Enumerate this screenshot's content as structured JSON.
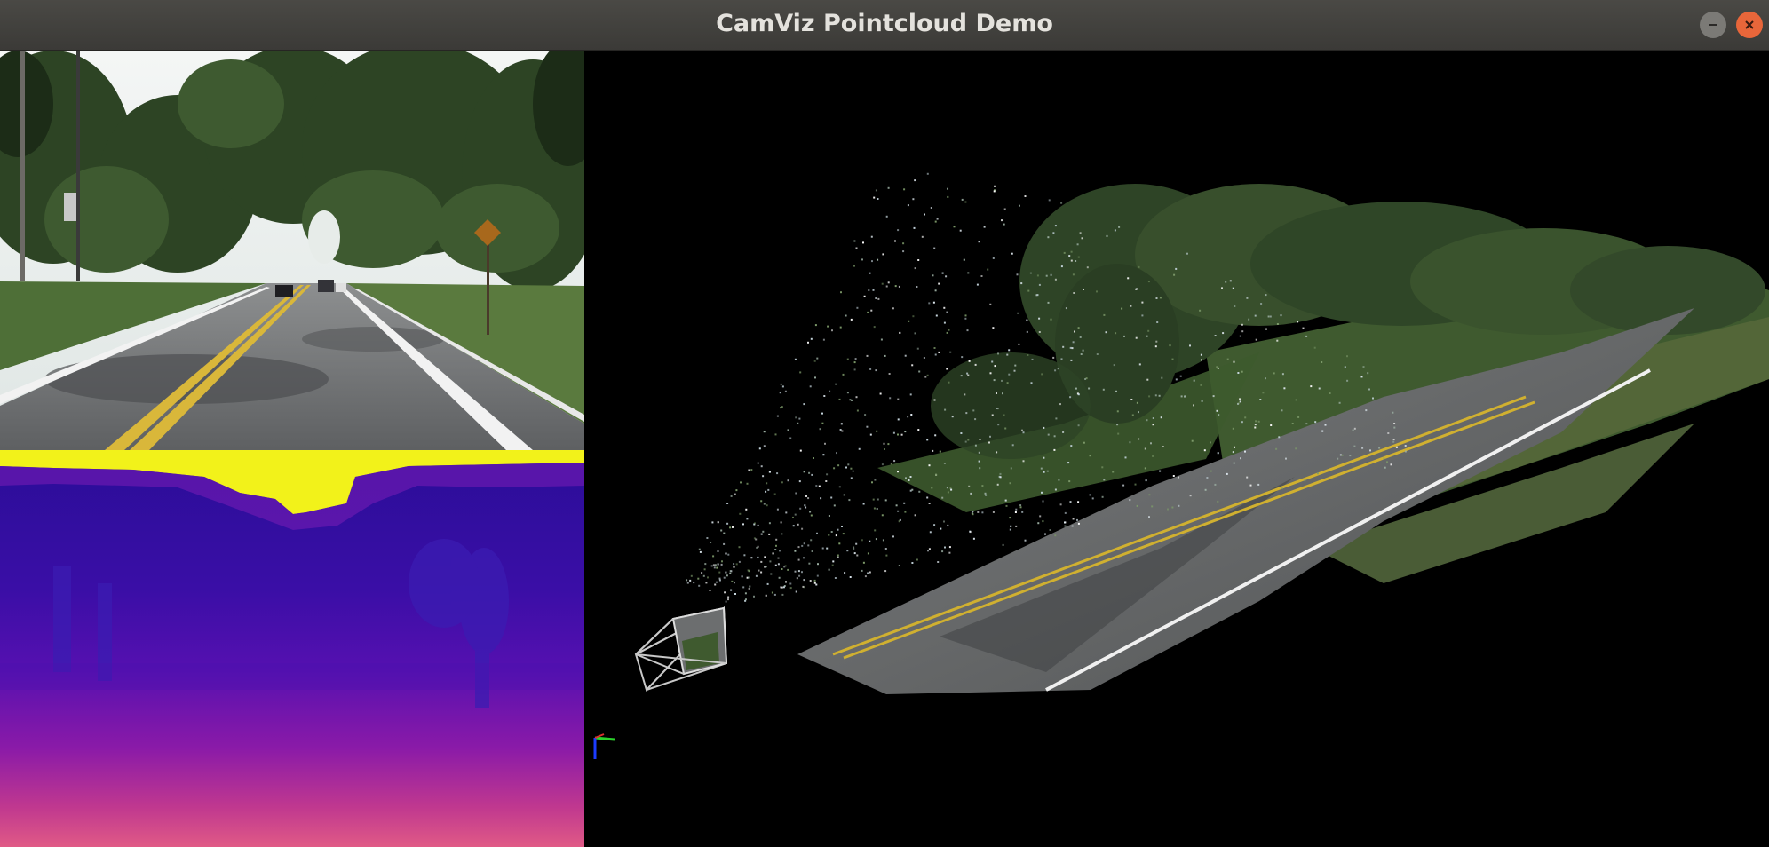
{
  "window": {
    "title": "CamViz Pointcloud Demo",
    "controls": {
      "minimize": "minimize-icon",
      "close": "close-icon"
    }
  },
  "panels": {
    "rgb": {
      "content": "street-scene"
    },
    "depth": {
      "content": "depth-map",
      "colormap": "plasma"
    },
    "viewer": {
      "content": "3d-pointcloud",
      "camera_frustum": true,
      "axes": [
        "x",
        "y",
        "z"
      ]
    }
  },
  "colors": {
    "titlebar": "#3d3c39",
    "title_text": "#e4e2dd",
    "close_button": "#e8663a",
    "minimize_button": "#7b7a76",
    "viewer_background": "#000000",
    "depth_far": "#f2f21a",
    "depth_mid": "#3a0ea6",
    "depth_near": "#e05a86"
  }
}
